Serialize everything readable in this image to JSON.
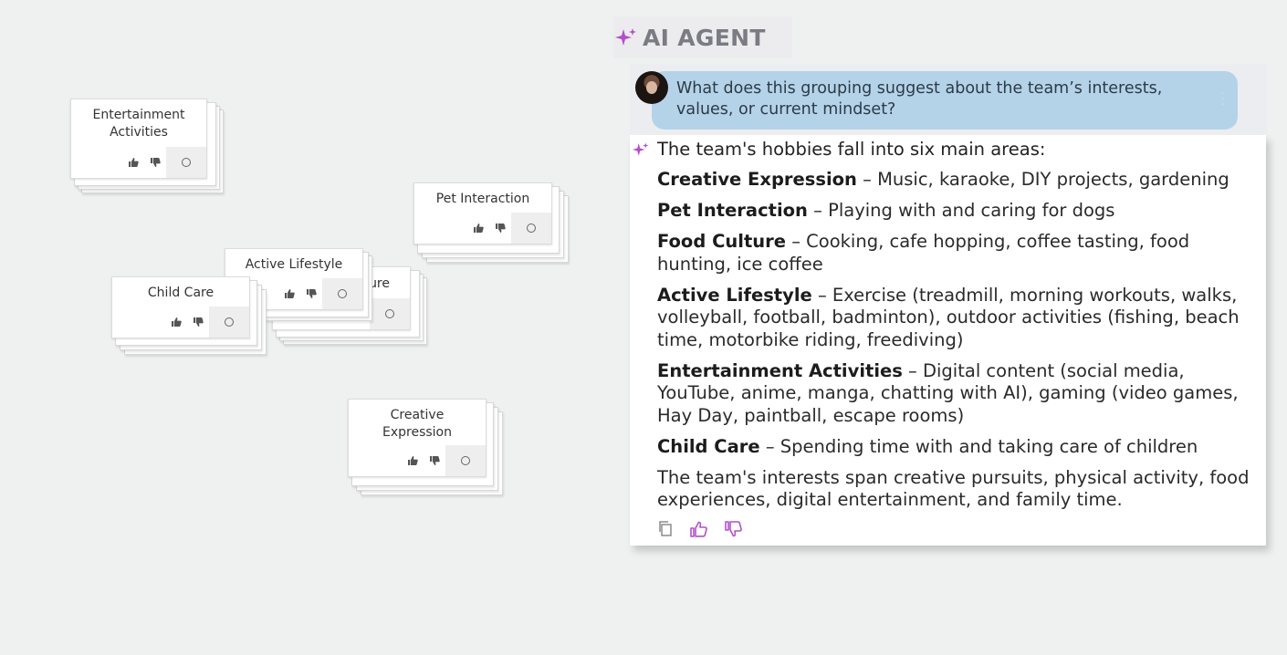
{
  "canvas": {
    "cards": [
      {
        "id": "entertainment",
        "title_line1": "Entertainment",
        "title_line2": "Activities"
      },
      {
        "id": "pet",
        "title_line1": "Pet Interaction",
        "title_line2": ""
      },
      {
        "id": "culture_partial",
        "title_line1": "ure",
        "title_line2": ""
      },
      {
        "id": "active",
        "title_line1": "Active Lifestyle",
        "title_line2": ""
      },
      {
        "id": "childcare",
        "title_line1": "Child Care",
        "title_line2": ""
      },
      {
        "id": "creative",
        "title_line1": "Creative",
        "title_line2": "Expression"
      }
    ]
  },
  "agent": {
    "title": "AI AGENT",
    "question": "What does this grouping suggest about the team’s interests, values, or current mindset?",
    "answer": {
      "intro": "The team's hobbies fall into six main areas:",
      "items": [
        {
          "term": "Creative Expression",
          "text": " – Music, karaoke, DIY projects, gardening"
        },
        {
          "term": "Pet Interaction",
          "text": " – Playing with and caring for dogs"
        },
        {
          "term": "Food Culture",
          "text": " – Cooking, cafe hopping, coffee tasting, food hunting, ice coffee"
        },
        {
          "term": "Active Lifestyle",
          "text": " – Exercise (treadmill, morning workouts, walks, volleyball, football, badminton), outdoor activities (fishing, beach time, motorbike riding, freediving)"
        },
        {
          "term": "Entertainment Activities",
          "text": " – Digital content (social media, YouTube, anime, manga, chatting with AI), gaming (video games, Hay Day, paintball, escape rooms)"
        },
        {
          "term": "Child Care",
          "text": " – Spending time with and taking care of children"
        }
      ],
      "summary": "The team's interests span creative pursuits, physical activity, food experiences, digital entertainment, and family time."
    },
    "actions": {
      "copy_icon": "copy-icon",
      "like_icon": "thumbs-up-icon",
      "dislike_icon": "thumbs-down-icon"
    },
    "colors": {
      "accent": "#b34fc9",
      "bubble": "#b5d3e8",
      "title": "#7b7b84"
    }
  }
}
